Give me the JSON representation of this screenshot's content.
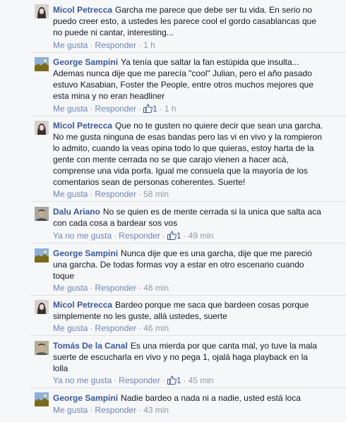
{
  "comments": [
    {
      "author": "Micol Petrecca",
      "avatar": "woman-portrait-avatar",
      "text": "Garcha me parece que debe ser tu vida. En serio no puedo creer esto, a ustedes les parece cool el gordo casablancas que no puede ni cantar, interesting...",
      "like_label": "Me gusta",
      "reply_label": "Responder",
      "time": "1 h"
    },
    {
      "author": "George Sampini",
      "avatar": "landscape-avatar",
      "text": "Ya tenía que saltar la fan estúpida que insulta... Ademas nunca dije que me parecía \"cool\" Julian, pero el año pasado estuvo Kasabian, Foster the People, entre otros muchos mejores que esta mina y no eran headliner",
      "like_label": "Me gusta",
      "reply_label": "Responder",
      "likes": "1",
      "time": "1 h"
    },
    {
      "author": "Micol Petrecca",
      "avatar": "woman-portrait-avatar",
      "text": "Que no te gusten no quiere decir que sean una garcha. No me gusta ninguna de esas bandas pero las vi en vivo y la rompieron lo admito, cuando la veas opina todo lo que quieras, estoy harta de la gente con mente cerrada no se que carajo vienen a hacer acá, comprense una vida porfa. Igual me consuela que la mayoría de los comentarios sean de personas coherentes. Suerte!",
      "like_label": "Me gusta",
      "reply_label": "Responder",
      "time": "58 min"
    },
    {
      "author": "Dalu Ariano",
      "avatar": "man-portrait-avatar",
      "text": "No se quien es de mente cerrada si la unica que salta aca con cada cosa a bardear sos vos",
      "like_label": "Ya no me gusta",
      "reply_label": "Responder",
      "likes": "1",
      "time": "49 min"
    },
    {
      "author": "George Sampini",
      "avatar": "landscape-avatar",
      "text": "Nunca dije que es una garcha, dije que me pareció una garcha. De todas formas voy a estar en otro escenario cuando toque",
      "like_label": "Me gusta",
      "reply_label": "Responder",
      "time": "48 min"
    },
    {
      "author": "Micol Petrecca",
      "avatar": "woman-portrait-avatar",
      "text": "Bardeo porque me saca que bardeen cosas porque simplemente no les guste, allá ustedes, suerte",
      "like_label": "Me gusta",
      "reply_label": "Responder",
      "time": "46 min"
    },
    {
      "author": "Tomás De la Canal",
      "avatar": "man-portrait-avatar",
      "text": "Es una mierda por que canta mal, yo tuve la mala suerte de escucharla en vivo y no pega 1, ojalá haga playback en la lolla",
      "like_label": "Ya no me gusta",
      "reply_label": "Responder",
      "likes": "1",
      "time": "45 min"
    },
    {
      "author": "George Sampini",
      "avatar": "landscape-avatar",
      "text": "Nadie bardeo a nada ni a nadie, usted está loca",
      "like_label": "Me gusta",
      "reply_label": "Responder",
      "time": "43 min"
    }
  ],
  "colors": {
    "author": "#3b5998",
    "link": "#6d84b4",
    "meta": "#9197a3",
    "background": "#f6f7f9"
  }
}
